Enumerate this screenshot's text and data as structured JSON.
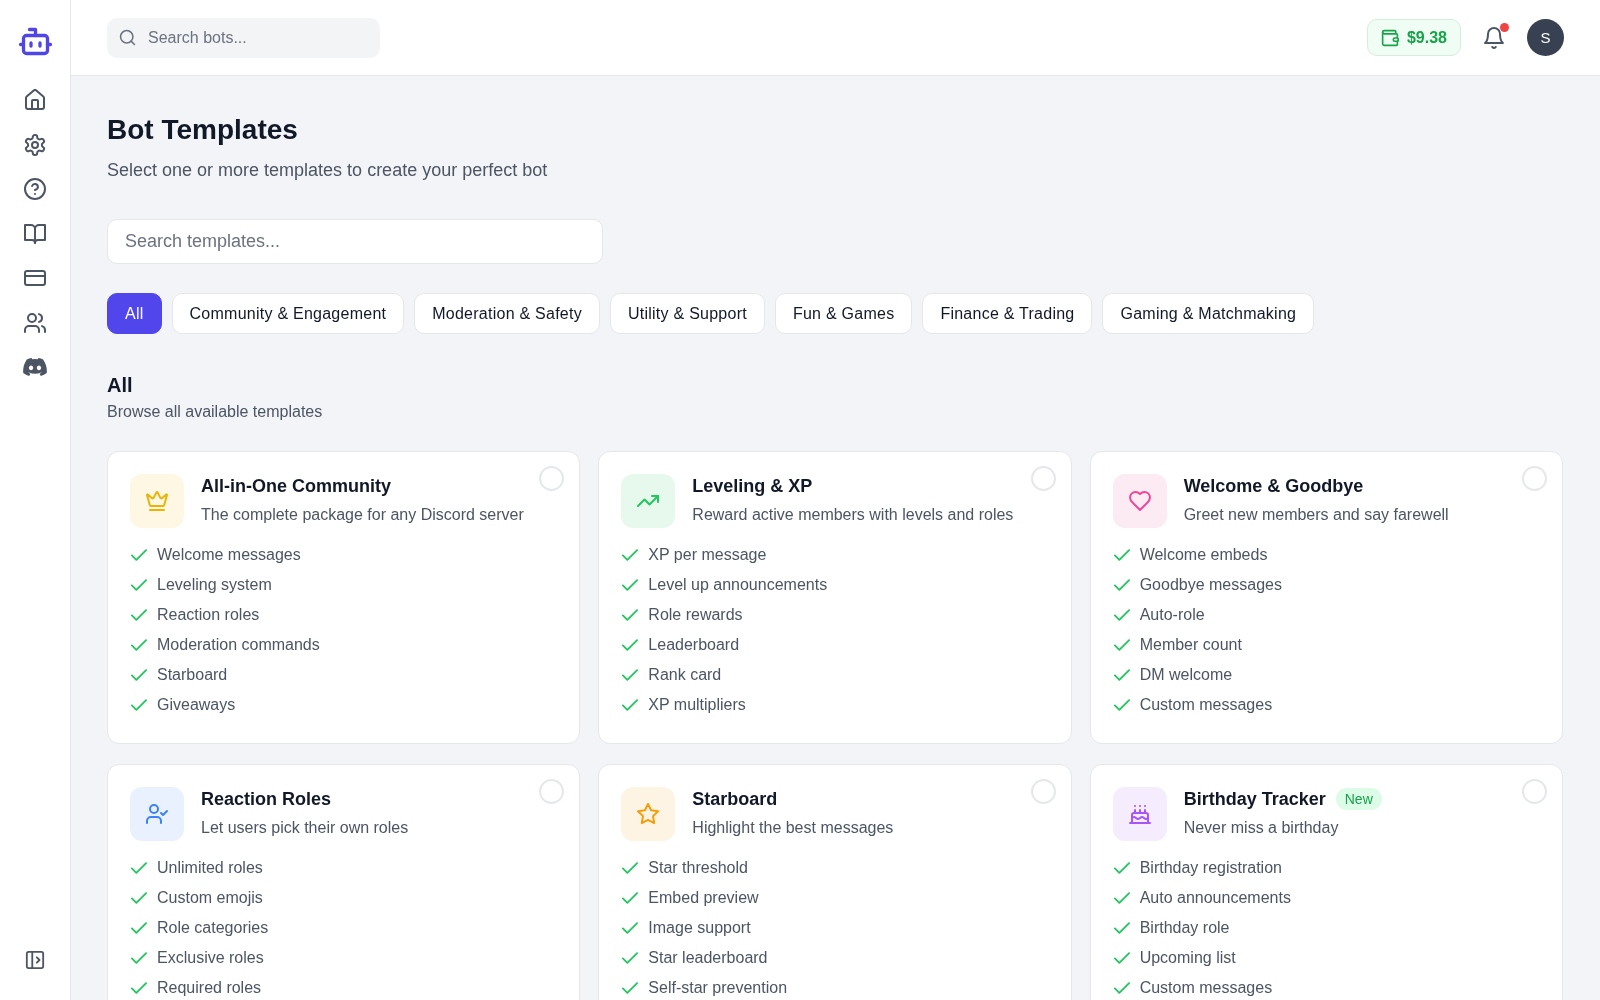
{
  "topbar": {
    "search": {
      "placeholder": "Search bots..."
    },
    "balance": "$9.38",
    "notifications": {
      "unread": true
    },
    "avatar": {
      "initial": "S"
    }
  },
  "header": {
    "title": "Bot Templates",
    "subtitle": "Select one or more templates to create your perfect bot"
  },
  "template_search": {
    "placeholder": "Search templates..."
  },
  "tabs": [
    {
      "label": "All",
      "selected": true
    },
    {
      "label": "Community & Engagement",
      "selected": false
    },
    {
      "label": "Moderation & Safety",
      "selected": false
    },
    {
      "label": "Utility & Support",
      "selected": false
    },
    {
      "label": "Fun & Games",
      "selected": false
    },
    {
      "label": "Finance & Trading",
      "selected": false
    },
    {
      "label": "Gaming & Matchmaking",
      "selected": false
    }
  ],
  "section": {
    "title": "All",
    "subtitle": "Browse all available templates"
  },
  "cards": [
    {
      "title": "All-in-One Community",
      "description": "The complete package for any Discord server",
      "color": "#eab308",
      "selected": false,
      "features": [
        "Welcome messages",
        "Leveling system",
        "Reaction roles",
        "Moderation commands",
        "Starboard",
        "Giveaways"
      ]
    },
    {
      "title": "Leveling & XP",
      "description": "Reward active members with levels and roles",
      "color": "#22c55e",
      "selected": false,
      "features": [
        "XP per message",
        "Level up announcements",
        "Role rewards",
        "Leaderboard",
        "Rank card",
        "XP multipliers"
      ]
    },
    {
      "title": "Welcome & Goodbye",
      "description": "Greet new members and say farewell",
      "color": "#ec4899",
      "selected": false,
      "features": [
        "Welcome embeds",
        "Goodbye messages",
        "Auto-role",
        "Member count",
        "DM welcome",
        "Custom messages"
      ]
    },
    {
      "title": "Reaction Roles",
      "description": "Let users pick their own roles",
      "color": "#3b82f6",
      "selected": false,
      "features": [
        "Unlimited roles",
        "Custom emojis",
        "Role categories",
        "Exclusive roles",
        "Required roles"
      ]
    },
    {
      "title": "Starboard",
      "description": "Highlight the best messages",
      "color": "#f59e0b",
      "selected": false,
      "features": [
        "Star threshold",
        "Embed preview",
        "Image support",
        "Star leaderboard",
        "Self-star prevention"
      ]
    },
    {
      "title": "Birthday Tracker",
      "badge": "New",
      "description": "Never miss a birthday",
      "color": "#a855f7",
      "selected": false,
      "features": [
        "Birthday registration",
        "Auto announcements",
        "Birthday role",
        "Upcoming list",
        "Custom messages"
      ]
    }
  ]
}
